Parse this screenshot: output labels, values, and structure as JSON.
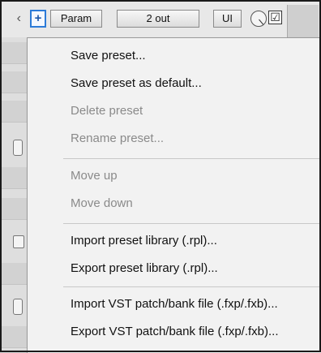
{
  "toolbar": {
    "chevron_icon": "chevron-left-icon",
    "add_label": "+",
    "param_label": "Param",
    "io_label": "2 out",
    "ui_label": "UI",
    "wet_knob_icon": "knob-icon",
    "enable_checked": true,
    "check_mark": "☑"
  },
  "menu": {
    "items": [
      {
        "label": "Save preset...",
        "enabled": true
      },
      {
        "label": "Save preset as default...",
        "enabled": true
      },
      {
        "label": "Delete preset",
        "enabled": false
      },
      {
        "label": "Rename preset...",
        "enabled": false
      },
      {
        "label": "Move up",
        "enabled": false
      },
      {
        "label": "Move down",
        "enabled": false
      },
      {
        "label": "Import preset library (.rpl)...",
        "enabled": true
      },
      {
        "label": "Export preset library (.rpl)...",
        "enabled": true
      },
      {
        "label": "Import VST patch/bank file (.fxp/.fxb)...",
        "enabled": true
      },
      {
        "label": "Export VST patch/bank file (.fxp/.fxb)...",
        "enabled": true
      }
    ]
  }
}
